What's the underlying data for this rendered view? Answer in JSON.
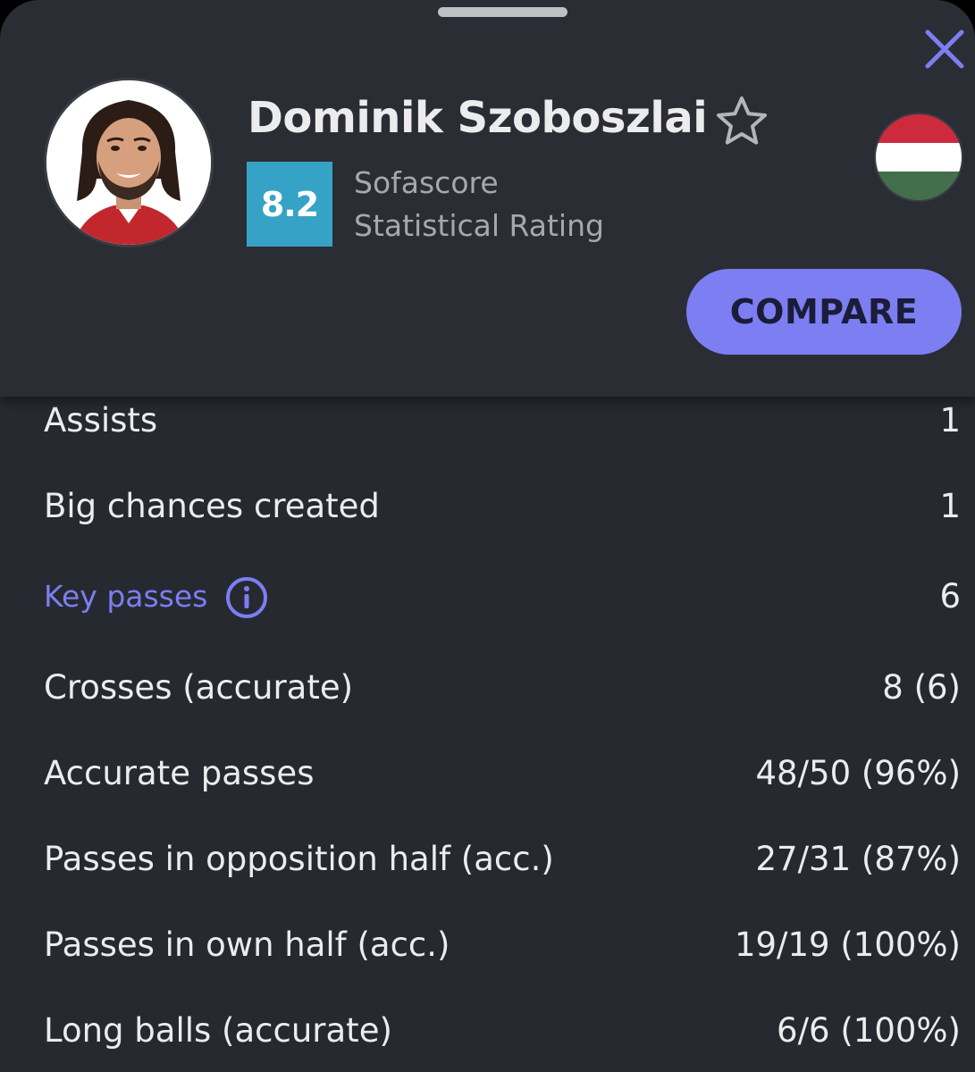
{
  "player": {
    "name": "Dominik Szoboszlai",
    "rating": "8.2",
    "rating_label_line1": "Sofascore",
    "rating_label_line2": "Statistical Rating",
    "rating_color": "#36a3c6",
    "nationality_flag": "hungary-flag",
    "flag_colors": [
      "#cd2a3e",
      "#ffffff",
      "#436f4d"
    ]
  },
  "actions": {
    "compare_label": "COMPARE",
    "accent_color": "#7c7ef2"
  },
  "stats": [
    {
      "label": "Assists",
      "value": "1",
      "link": false
    },
    {
      "label": "Big chances created",
      "value": "1",
      "link": false
    },
    {
      "label": "Key passes",
      "value": "6",
      "link": true,
      "icon": "info-icon"
    },
    {
      "label": "Crosses (accurate)",
      "value": "8 (6)",
      "link": false
    },
    {
      "label": "Accurate passes",
      "value": "48/50 (96%)",
      "link": false
    },
    {
      "label": "Passes in opposition half (acc.)",
      "value": "27/31 (87%)",
      "link": false
    },
    {
      "label": "Passes in own half (acc.)",
      "value": "19/19 (100%)",
      "link": false
    },
    {
      "label": "Long balls (accurate)",
      "value": "6/6 (100%)",
      "link": false
    }
  ]
}
